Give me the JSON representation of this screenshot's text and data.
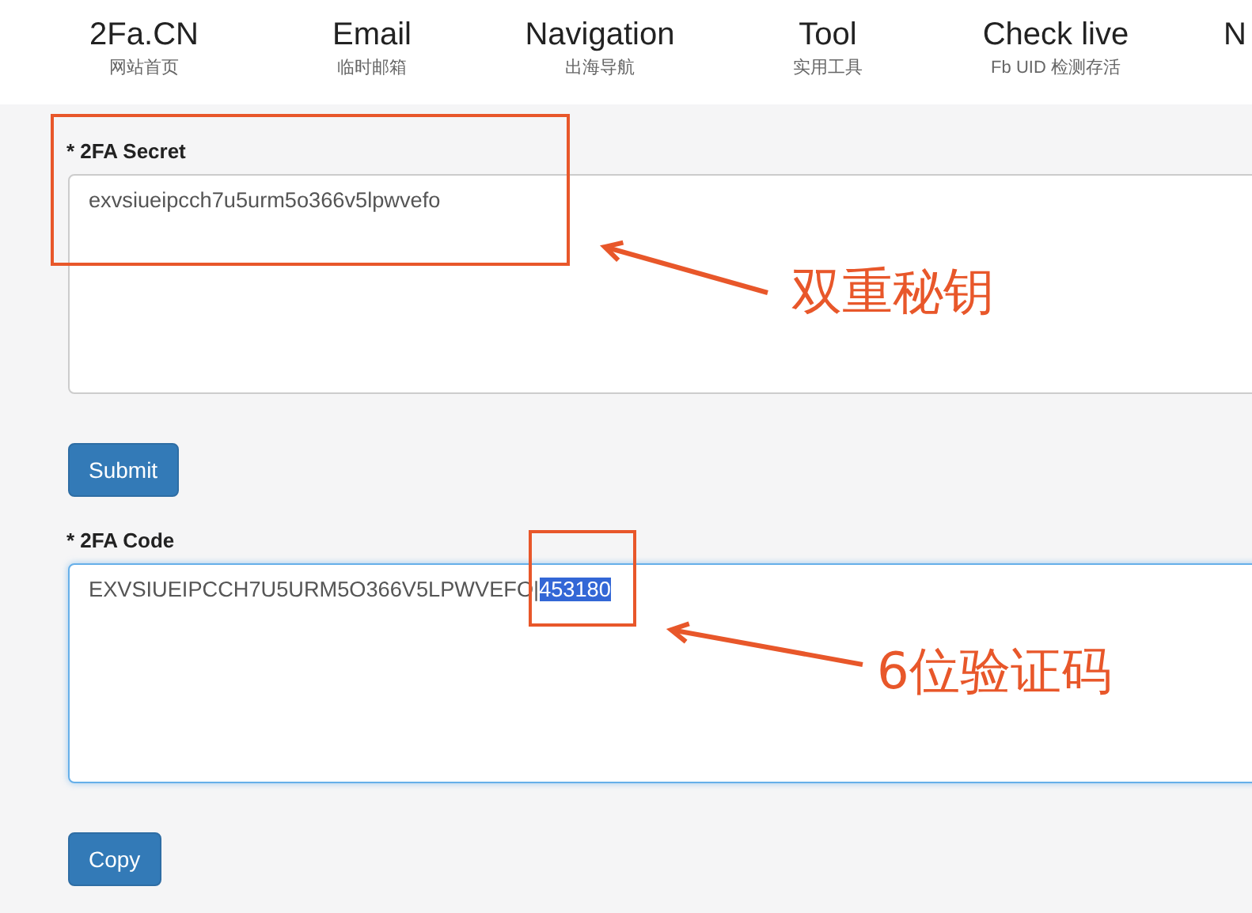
{
  "nav": [
    {
      "title": "2Fa.CN",
      "subtitle": "网站首页"
    },
    {
      "title": "Email",
      "subtitle": "临时邮箱"
    },
    {
      "title": "Navigation",
      "subtitle": "出海导航"
    },
    {
      "title": "Tool",
      "subtitle": "实用工具"
    },
    {
      "title": "Check live",
      "subtitle": "Fb UID 检测存活"
    },
    {
      "title": "N",
      "kind": "cut"
    }
  ],
  "secret": {
    "label": "* 2FA Secret",
    "value": "exvsiueipcch7u5urm5o366v5lpwvefo",
    "button": "Submit"
  },
  "code": {
    "label": "* 2FA Code",
    "value": "EXVSIUEIPCCH7U5URM5O366V5LPWVEFO|",
    "selected_text": "453180",
    "focused": true,
    "button": "Copy"
  },
  "annotations": [
    {
      "label": "双重秘钥"
    },
    {
      "label": "6位验证码"
    }
  ]
}
